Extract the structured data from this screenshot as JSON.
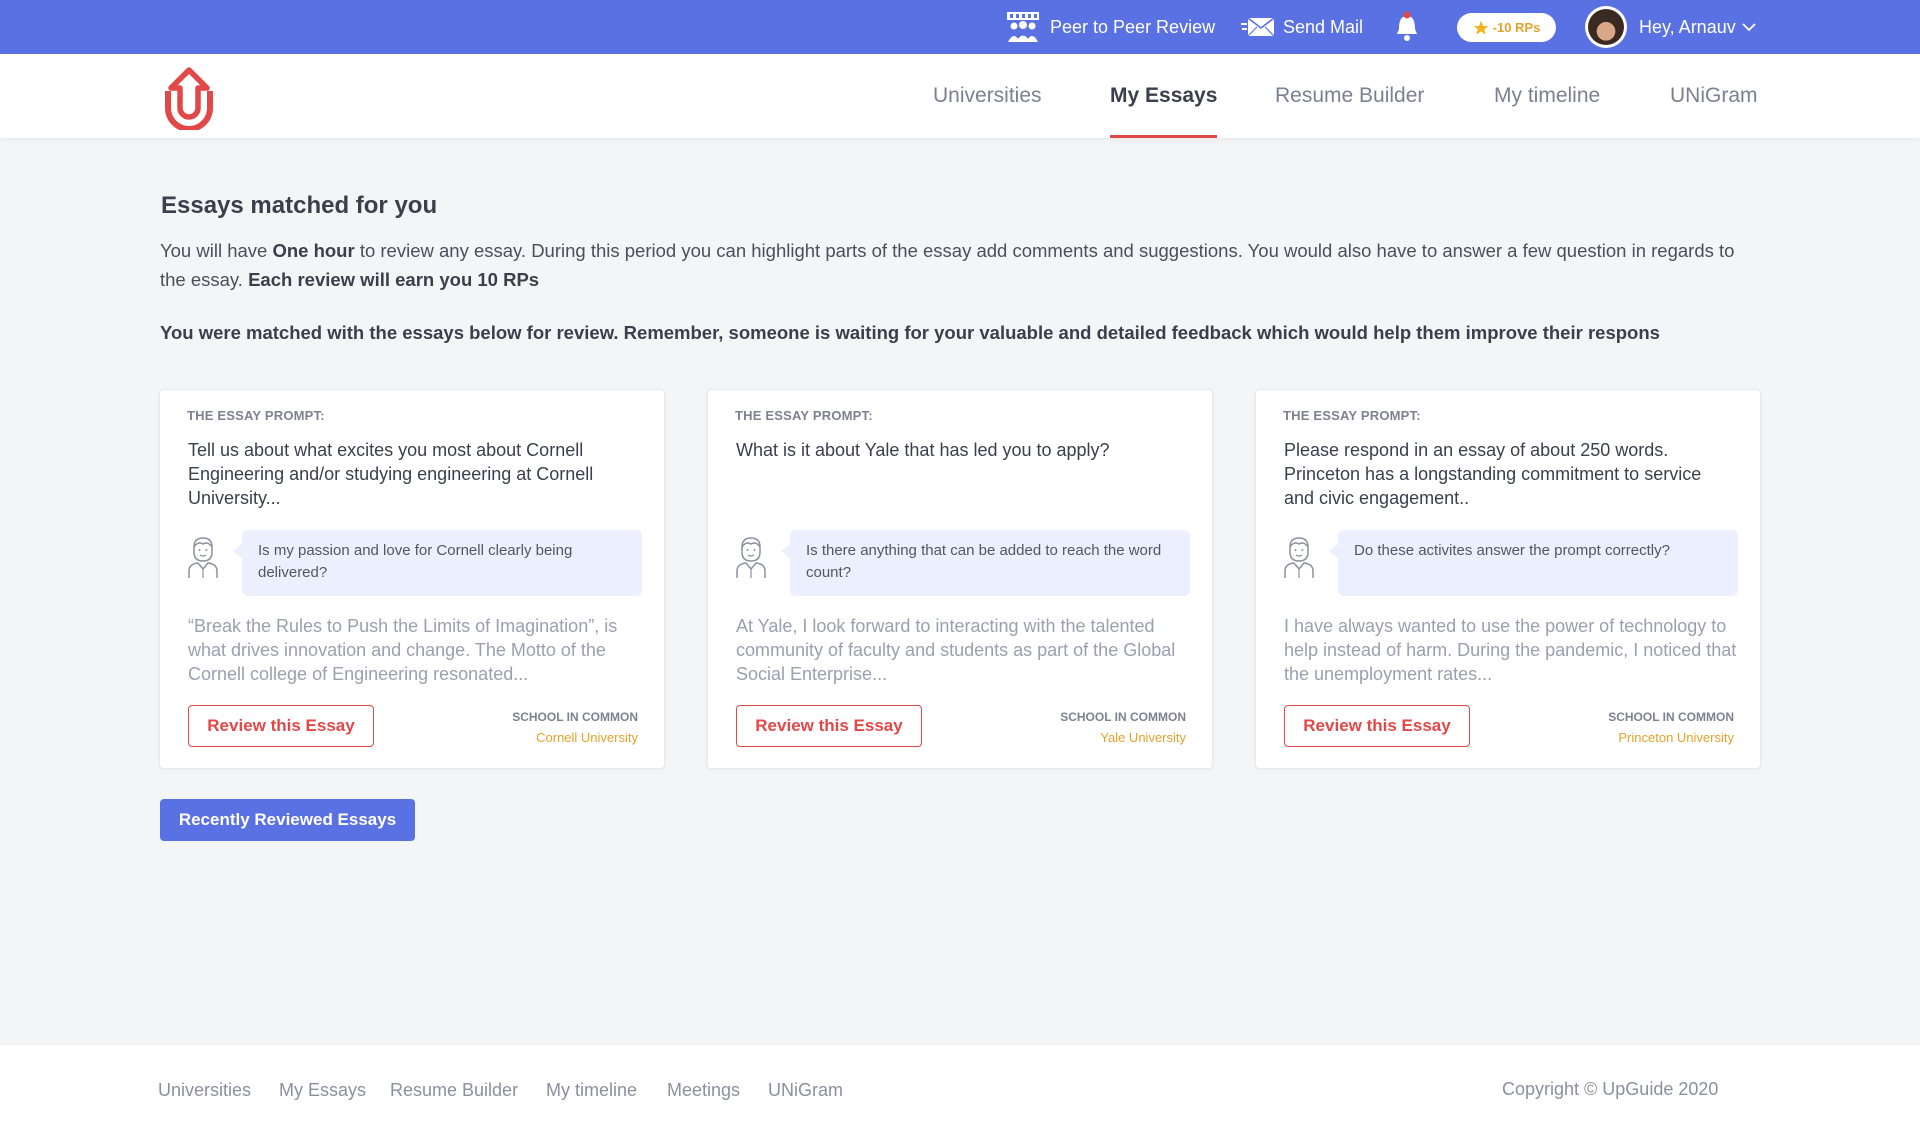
{
  "topbar": {
    "peer_review": "Peer to Peer Review",
    "send_mail": "Send Mail",
    "rp_badge": "-10 RPs",
    "greeting": "Hey, Arnauv"
  },
  "nav": {
    "links": [
      "Universities",
      "My Essays",
      "Resume Builder",
      "My timeline",
      "UNiGram"
    ],
    "active": "My Essays"
  },
  "page": {
    "heading": "Essays matched for you",
    "intro_part1": "You will have ",
    "intro_bold1": "One hour",
    "intro_part2": " to review any essay. During this period you can highlight parts of the essay add comments and suggestions. You would also have to answer a few question in regards to the essay. ",
    "intro_bold2": "Each review will earn you 10 RPs",
    "matched_text": "You were matched with the essays below for review. Remember, someone is waiting for your valuable and detailed feedback which would help them improve their respons"
  },
  "cards": [
    {
      "prompt_label": "THE ESSAY PROMPT:",
      "prompt": "Tell us about what excites you most about Cornell Engineering and/or studying engineering at Cornell University...",
      "question": "Is my passion and love for Cornell clearly being delivered?",
      "excerpt": "“Break the Rules to Push the Limits of Imagination”, is what drives innovation and change. The Motto of the Cornell college of Engineering resonated...",
      "button": "Review this Essay",
      "school_label": "SCHOOL IN COMMON",
      "school": "Cornell University"
    },
    {
      "prompt_label": "THE ESSAY PROMPT:",
      "prompt": "What is it about Yale that has led you to apply?",
      "question": "Is there anything that can be added to reach the word count?",
      "excerpt": "At Yale, I look forward to interacting with the talented community of faculty and students  as part of the Global Social Enterprise...",
      "button": "Review this Essay",
      "school_label": "SCHOOL IN COMMON",
      "school": "Yale University"
    },
    {
      "prompt_label": "THE ESSAY PROMPT:",
      "prompt": "Please respond in an essay of about 250 words. Princeton has a longstanding commitment to service and civic engagement..",
      "question": "Do these activites answer the prompt correctly?",
      "excerpt": "I have always wanted to use the power of technology to help instead of harm. During the pandemic, I noticed that the unemployment rates...",
      "button": "Review this Essay",
      "school_label": "SCHOOL IN COMMON",
      "school": "Princeton University"
    }
  ],
  "recent_button": "Recently Reviewed Essays",
  "footer": {
    "links": [
      "Universities",
      "My Essays",
      "Resume Builder",
      "My timeline",
      "Meetings",
      "UNiGram"
    ],
    "copyright": "Copyright © UpGuide 2020"
  },
  "colors": {
    "brand_blue": "#5a71e3",
    "accent_red": "#e24848",
    "school_gold": "#e3a22b",
    "bubble_bg": "#eceffd"
  },
  "icons": [
    "peer-review-icon",
    "mail-icon",
    "bell-icon",
    "star-icon",
    "chevron-down-icon",
    "student-icon",
    "upguide-logo"
  ]
}
